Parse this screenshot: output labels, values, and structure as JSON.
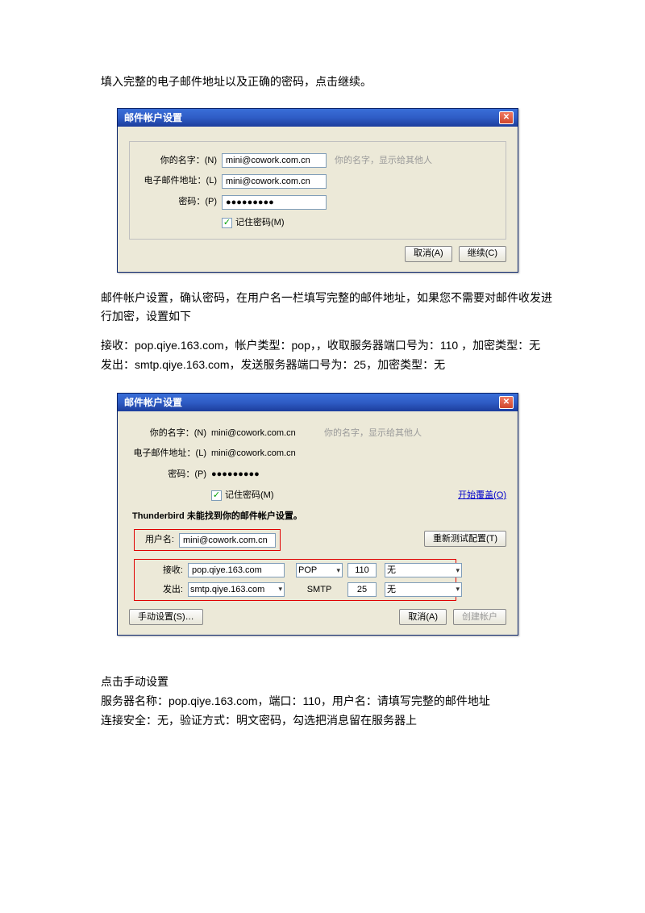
{
  "text": {
    "p1": "填入完整的电子邮件地址以及正确的密码，点击继续。",
    "p2": "邮件帐户设置，确认密码，在用户名一栏填写完整的邮件地址，如果您不需要对邮件收发进行加密，设置如下",
    "p3": "接收：pop.qiye.163.com，帐户类型：pop，，收取服务器端口号为：110 ，加密类型：无",
    "p4": "发出：smtp.qiye.163.com，发送服务器端口号为：25，加密类型：无",
    "p5": "点击手动设置",
    "p6": "服务器名称：pop.qiye.163.com，端口：110，用户名：请填写完整的邮件地址",
    "p7": "连接安全：无，验证方式：明文密码，勾选把消息留在服务器上"
  },
  "d1": {
    "title": "邮件帐户设置",
    "name_label": "你的名字：(N)",
    "name_value": "mini@cowork.com.cn",
    "name_hint": "你的名字，显示给其他人",
    "email_label": "电子邮件地址：(L)",
    "email_value": "mini@cowork.com.cn",
    "pw_label": "密码：(P)",
    "pw_value": "●●●●●●●●●",
    "remember": "记住密码(M)",
    "cancel": "取消(A)",
    "continue": "继续(C)"
  },
  "d2": {
    "title": "邮件帐户设置",
    "name_label": "你的名字：(N)",
    "name_value": "mini@cowork.com.cn",
    "name_hint": "你的名字，显示给其他人",
    "email_label": "电子邮件地址：(L)",
    "email_value": "mini@cowork.com.cn",
    "pw_label": "密码：(P)",
    "pw_value": "●●●●●●●●●",
    "remember": "记住密码(M)",
    "restart_link": "开始覆盖(O)",
    "section": "Thunderbird 未能找到你的邮件帐户设置。",
    "user_label": "用户名:",
    "user_value": "mini@cowork.com.cn",
    "retest": "重新测试配置(T)",
    "recv_label": "接收:",
    "recv_server": "pop.qiye.163.com",
    "recv_proto": "POP",
    "recv_port": "110",
    "recv_enc": "无",
    "send_label": "发出:",
    "send_server": "smtp.qiye.163.com",
    "send_proto": "SMTP",
    "send_port": "25",
    "send_enc": "无",
    "manual": "手动设置(S)…",
    "cancel": "取消(A)",
    "create": "创建帐户"
  }
}
